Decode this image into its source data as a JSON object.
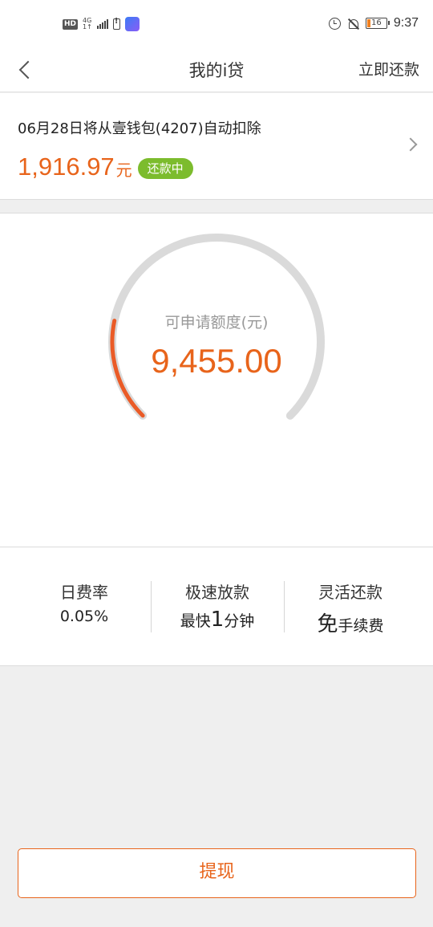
{
  "status_bar": {
    "hd": "HD",
    "net_top": "4G",
    "net_bottom": "1↑",
    "battery_level": "16",
    "time": "9:37"
  },
  "header": {
    "title": "我的i贷",
    "action": "立即还款"
  },
  "repayment": {
    "description": "06月28日将从壹钱包(4207)自动扣除",
    "amount": "1,916.97",
    "unit": "元",
    "status": "还款中"
  },
  "quota": {
    "label": "可申请额度(元)",
    "value": "9,455.00",
    "used_fraction": 0.21
  },
  "features": [
    {
      "title": "日费率",
      "value": "0.05%"
    },
    {
      "title": "极速放款",
      "value_pre": "最快",
      "value_big": "1",
      "value_post": "分钟"
    },
    {
      "title": "灵活还款",
      "value_big": "免",
      "value_post": "手续费"
    }
  ],
  "withdraw_label": "提现",
  "colors": {
    "accent": "#e8641b",
    "badge": "#7cbc2d"
  }
}
